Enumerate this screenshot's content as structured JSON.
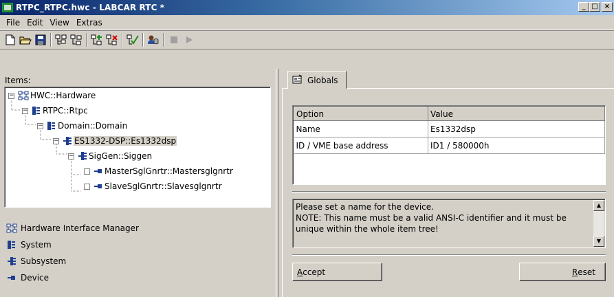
{
  "window": {
    "title": "RTPC_RTPC.hwc - LABCAR RTC  *",
    "minimize": "_",
    "maximize": "□",
    "close": "×"
  },
  "menu": [
    "File",
    "Edit",
    "View",
    "Extras"
  ],
  "toolbar": {
    "icons": [
      "new-document-icon",
      "open-folder-icon",
      "save-icon",
      "tree-expand-icon",
      "tree-collapse-icon",
      "tree-add-icon",
      "tree-remove-icon",
      "check-icon",
      "database-user-icon",
      "stop-icon",
      "play-icon"
    ]
  },
  "items_label": "Items:",
  "tree": [
    {
      "label": "HWC::Hardware",
      "level": 0,
      "icon": "hardware-manager-icon",
      "expander": "−"
    },
    {
      "label": "RTPC::Rtpc",
      "level": 1,
      "icon": "system-icon",
      "expander": "−"
    },
    {
      "label": "Domain::Domain",
      "level": 2,
      "icon": "system-icon",
      "expander": "−"
    },
    {
      "label": "ES1332-DSP::Es1332dsp",
      "level": 3,
      "icon": "subsystem-icon",
      "expander": "−",
      "selected": true
    },
    {
      "label": "SigGen::Siggen",
      "level": 4,
      "icon": "subsystem-icon",
      "expander": "−"
    },
    {
      "label": "MasterSglGnrtr::Mastersglgnrtr",
      "level": 5,
      "icon": "device-icon",
      "expander": ""
    },
    {
      "label": "SlaveSglGnrtr::Slavesglgnrtr",
      "level": 5,
      "icon": "device-icon",
      "expander": ""
    }
  ],
  "legend": [
    {
      "label": "Hardware Interface Manager",
      "icon": "hardware-manager-icon"
    },
    {
      "label": "System",
      "icon": "system-icon"
    },
    {
      "label": "Subsystem",
      "icon": "subsystem-icon"
    },
    {
      "label": "Device",
      "icon": "device-icon"
    }
  ],
  "tab": {
    "label": "Globals"
  },
  "options": {
    "headers": [
      "Option",
      "Value"
    ],
    "rows": [
      [
        "Name",
        "Es1332dsp"
      ],
      [
        "ID / VME base address",
        "ID1 / 580000h"
      ]
    ]
  },
  "description": "Please set a name for the device.\nNOTE: This name must be a valid ANSI-C identifier and it must be unique within the whole item tree!",
  "buttons": {
    "accept_prefix": "A",
    "accept_rest": "ccept",
    "reset_prefix": "R",
    "reset_rest": "eset"
  },
  "colors": {
    "titlebar_start": "#0a246a",
    "titlebar_end": "#a6caf0",
    "face": "#d4d0c8"
  }
}
